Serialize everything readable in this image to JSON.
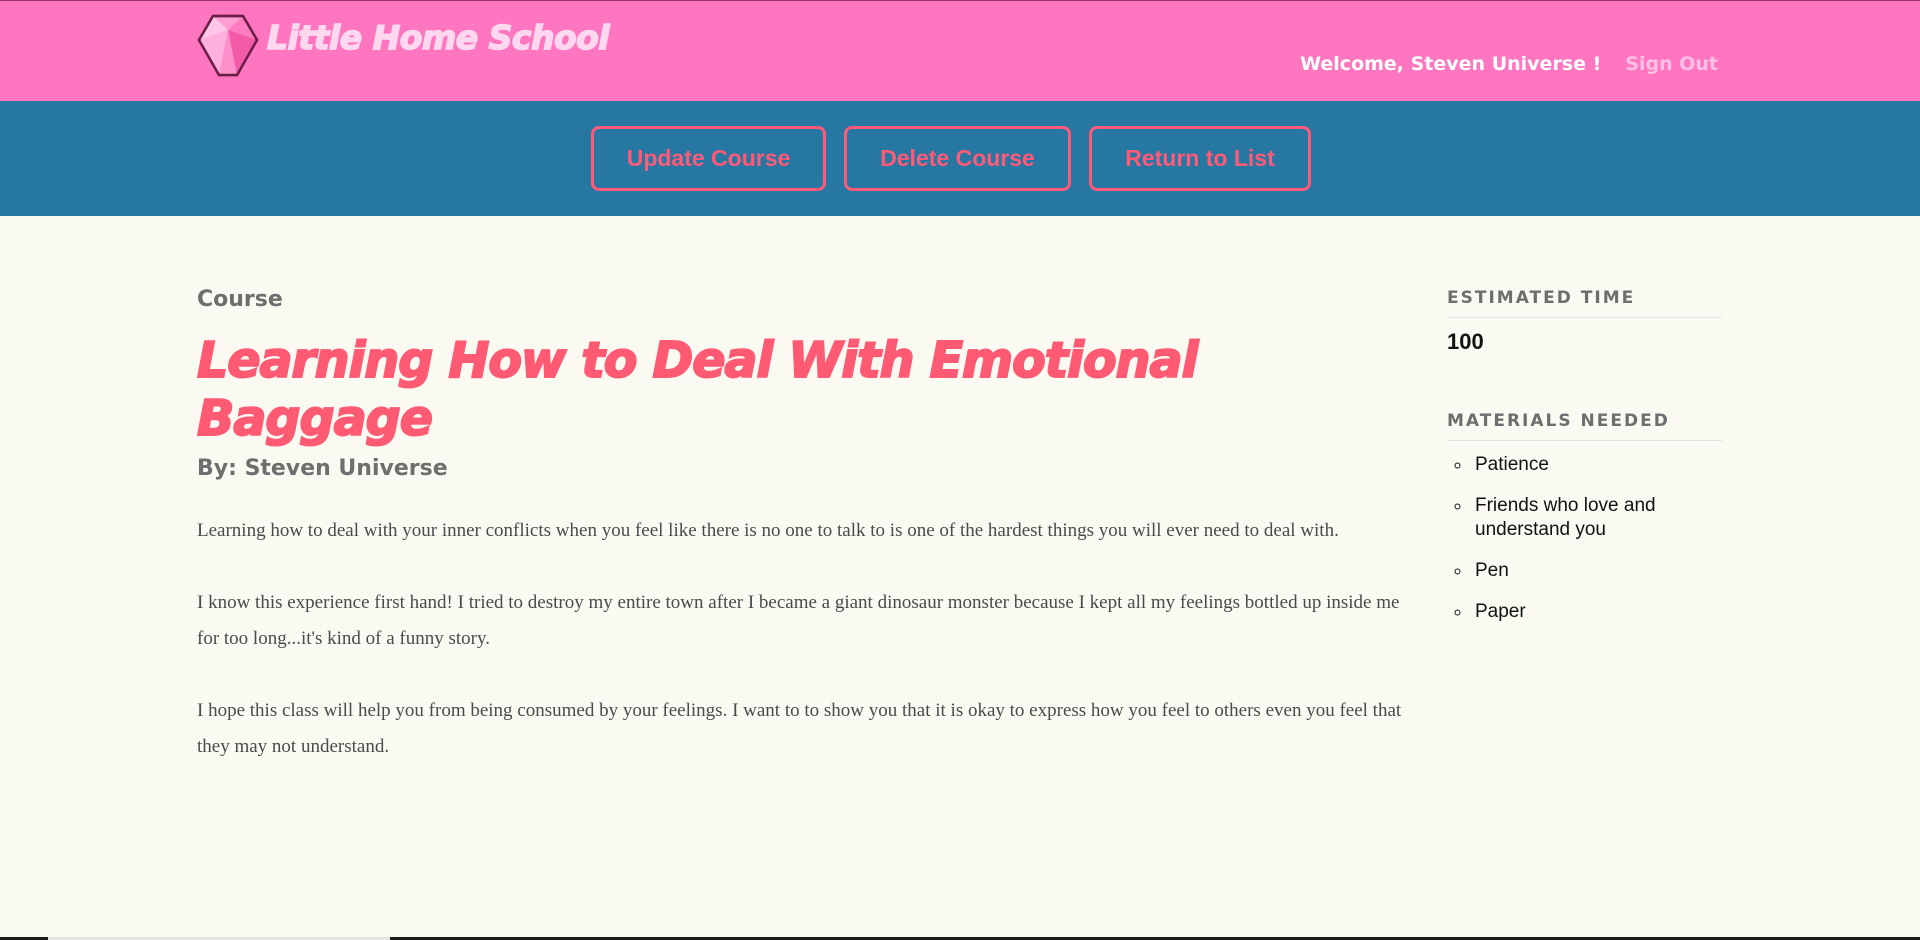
{
  "header": {
    "logo_text": "Little Home School",
    "welcome": "Welcome, Steven Universe !",
    "sign_out": "Sign Out"
  },
  "actions": {
    "update": "Update Course",
    "delete": "Delete Course",
    "return": "Return to List"
  },
  "course": {
    "label": "Course",
    "title": "Learning How to Deal With Emotional Baggage",
    "author": "By: Steven Universe",
    "description": [
      "Learning how to deal with your inner conflicts when you feel like there is no one to talk to is one of the hardest things you will ever need to deal with.",
      "I know this experience first hand! I tried to destroy my entire town after I became a giant dinosaur monster because I kept all my feelings bottled up inside me for too long...it's kind of a funny story.",
      "I hope this class will help you from being consumed by your feelings. I want to to show you that it is okay to express how you feel to others even you feel that they may not understand."
    ]
  },
  "sidebar": {
    "estimated_time_heading": "ESTIMATED TIME",
    "estimated_time_value": "100",
    "materials_heading": "MATERIALS NEEDED",
    "materials": [
      "Patience",
      "Friends who love and understand you",
      "Pen",
      "Paper"
    ]
  },
  "colors": {
    "header_bg": "#ff76c0",
    "action_bar_bg": "#2677a1",
    "accent": "#ff5a73",
    "page_bg": "#fbfaf2"
  },
  "icons": {
    "logo": "pink-gem-icon"
  }
}
